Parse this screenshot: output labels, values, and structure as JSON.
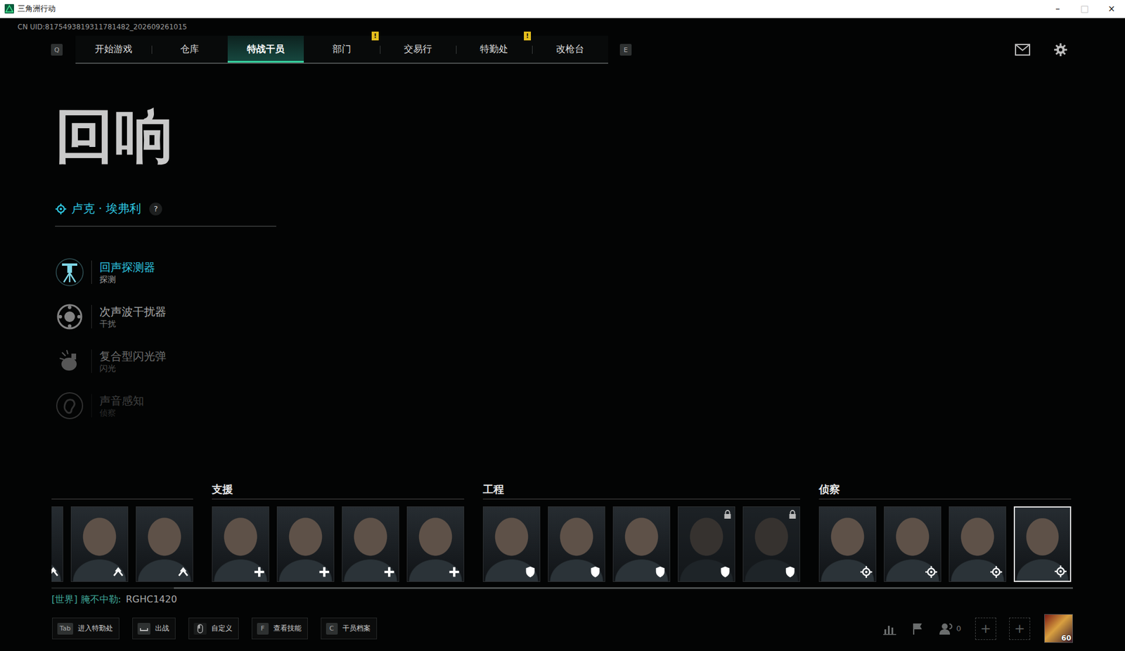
{
  "window": {
    "title": "三角洲行动",
    "controls": [
      {
        "glyph": "–",
        "disabled": false
      },
      {
        "glyph": "□",
        "disabled": true
      },
      {
        "glyph": "×",
        "disabled": false
      }
    ]
  },
  "uid": "CN UID:8175493819311781482_202609261015",
  "nav": {
    "prev_key": "Q",
    "next_key": "E",
    "alert_glyph": "!",
    "tabs": [
      {
        "label": "开始游戏",
        "selected": false,
        "alert": false
      },
      {
        "label": "仓库",
        "selected": false,
        "alert": false
      },
      {
        "label": "特战干员",
        "selected": true,
        "alert": false
      },
      {
        "label": "部门",
        "selected": false,
        "alert": true
      },
      {
        "label": "交易行",
        "selected": false,
        "alert": false
      },
      {
        "label": "特勤处",
        "selected": false,
        "alert": true
      },
      {
        "label": "改枪台",
        "selected": false,
        "alert": false
      }
    ]
  },
  "operator": {
    "name": "回响",
    "real_name": "卢克 · 埃弗利",
    "help": "?"
  },
  "skills": [
    {
      "name": "回声探测器",
      "type": "探测",
      "selected": true,
      "kind": "detector"
    },
    {
      "name": "次声波干扰器",
      "type": "干扰",
      "selected": false,
      "kind": "jammer"
    },
    {
      "name": "复合型闪光弹",
      "type": "闪光",
      "selected": false,
      "kind": "flash"
    },
    {
      "name": "声音感知",
      "type": "侦察",
      "selected": false,
      "kind": "hearing"
    }
  ],
  "roster": {
    "groups": [
      {
        "operators": [
          {
            "kind": "assault",
            "locked": false,
            "selected": false
          },
          {
            "kind": "assault",
            "locked": false,
            "selected": false
          },
          {
            "kind": "assault",
            "locked": false,
            "selected": false
          }
        ]
      },
      {
        "label": "支援",
        "operators": [
          {
            "kind": "support",
            "locked": false,
            "selected": false
          },
          {
            "kind": "support",
            "locked": false,
            "selected": false
          },
          {
            "kind": "support",
            "locked": false,
            "selected": false
          },
          {
            "kind": "support",
            "locked": false,
            "selected": false
          }
        ]
      },
      {
        "label": "工程",
        "operators": [
          {
            "kind": "engineer",
            "locked": false,
            "selected": false
          },
          {
            "kind": "engineer",
            "locked": false,
            "selected": false
          },
          {
            "kind": "engineer",
            "locked": false,
            "selected": false
          },
          {
            "kind": "engineer",
            "locked": true,
            "selected": false
          },
          {
            "kind": "engineer",
            "locked": true,
            "selected": false
          }
        ]
      },
      {
        "label": "侦察",
        "operators": [
          {
            "kind": "recon",
            "locked": false,
            "selected": false
          },
          {
            "kind": "recon",
            "locked": false,
            "selected": false
          },
          {
            "kind": "recon",
            "locked": false,
            "selected": false
          },
          {
            "kind": "recon",
            "locked": false,
            "selected": true
          }
        ]
      }
    ],
    "scrollbar": {
      "level": 0.88
    }
  },
  "chat": {
    "channel": "[世界] 腌不中勒:",
    "message": "RGHC1420"
  },
  "hints": [
    {
      "kind": "key",
      "key": "Tab",
      "label": "进入特勤处"
    },
    {
      "kind": "space",
      "label": "出战"
    },
    {
      "kind": "mouse",
      "label": "自定义"
    },
    {
      "kind": "key",
      "key": "F",
      "label": "查看技能"
    },
    {
      "kind": "key",
      "key": "C",
      "label": "干员档案"
    }
  ],
  "social": {
    "friends": "0",
    "party_slots": [
      {
        "glyph": "+"
      },
      {
        "glyph": "+"
      }
    ],
    "level": "60"
  }
}
